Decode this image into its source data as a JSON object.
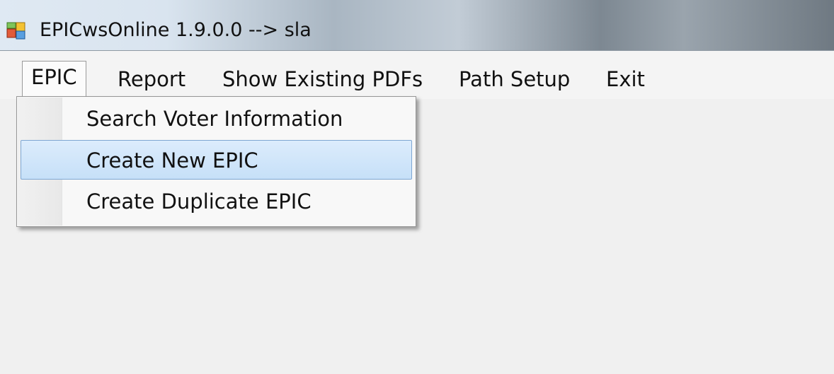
{
  "window": {
    "title": "EPICwsOnline 1.9.0.0 --> sla",
    "icon": "app-window-icon"
  },
  "menubar": {
    "items": [
      {
        "label": "EPIC"
      },
      {
        "label": "Report"
      },
      {
        "label": "Show Existing PDFs"
      },
      {
        "label": "Path Setup"
      },
      {
        "label": "Exit"
      }
    ]
  },
  "dropdown": {
    "parent": "EPIC",
    "items": [
      {
        "label": "Search Voter Information"
      },
      {
        "label": "Create New EPIC",
        "highlighted": true
      },
      {
        "label": "Create Duplicate EPIC"
      }
    ]
  },
  "colors": {
    "highlight_fill": "#c6e0f8",
    "highlight_border": "#7ea6d2",
    "client_background": "#f0f0f0"
  }
}
